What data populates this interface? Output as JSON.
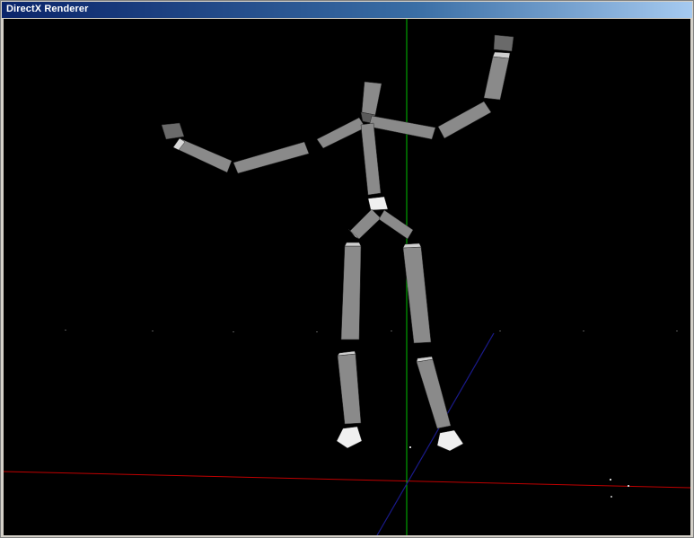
{
  "window": {
    "title": "DirectX Renderer"
  },
  "scene": {
    "background_color": "#000000",
    "axes": [
      {
        "name": "x-axis",
        "color": "#c00000"
      },
      {
        "name": "y-axis",
        "color": "#00c000"
      },
      {
        "name": "z-axis",
        "color": "#1a1a8a"
      }
    ],
    "bone_color_side": "#6e6e6e",
    "bone_color_front": "#9a9a9a",
    "bone_color_top": "#e8e8e8",
    "bones": [
      "head",
      "neck",
      "left-clavicle",
      "left-upper-arm",
      "left-forearm",
      "left-hand",
      "right-clavicle",
      "right-upper-arm",
      "right-forearm",
      "right-hand",
      "spine",
      "pelvis",
      "left-hip",
      "right-hip",
      "left-thigh",
      "left-shin",
      "left-foot",
      "right-thigh",
      "right-shin",
      "right-foot"
    ]
  }
}
